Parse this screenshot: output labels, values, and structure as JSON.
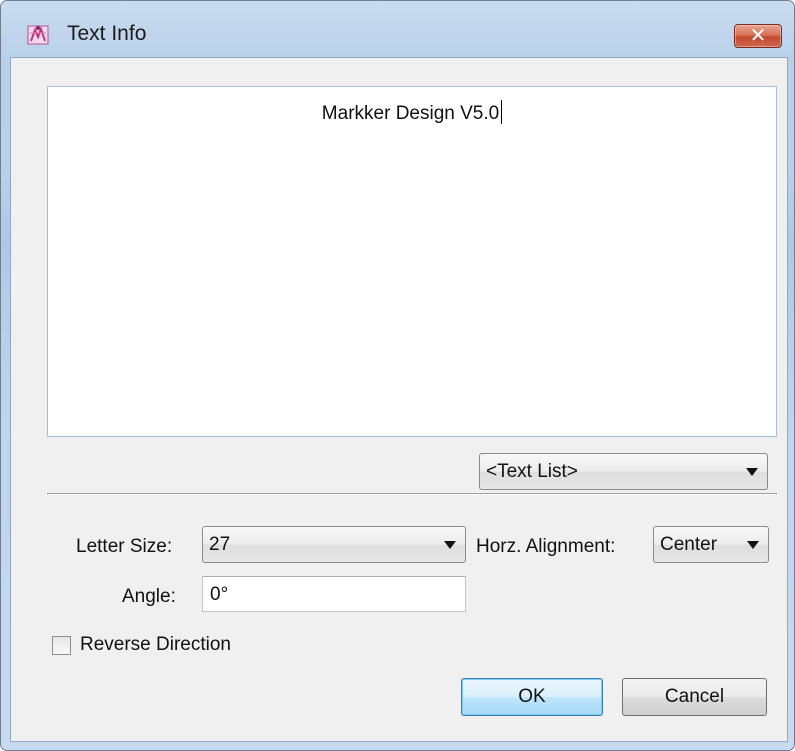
{
  "window": {
    "title": "Text Info",
    "icon": "app-logo-icon",
    "close_label": "✕"
  },
  "editor": {
    "text": "Markker Design V5.0"
  },
  "text_list": {
    "selected": "<Text List>"
  },
  "letter_size": {
    "label": "Letter Size:",
    "value": "27"
  },
  "horz_alignment": {
    "label": "Horz. Alignment:",
    "value": "Center"
  },
  "angle": {
    "label": "Angle:",
    "value": "0°"
  },
  "reverse_direction": {
    "label": "Reverse Direction",
    "checked": false
  },
  "buttons": {
    "ok": "OK",
    "cancel": "Cancel"
  },
  "colors": {
    "accent": "#3c7fb1",
    "close": "#c24a2f"
  }
}
